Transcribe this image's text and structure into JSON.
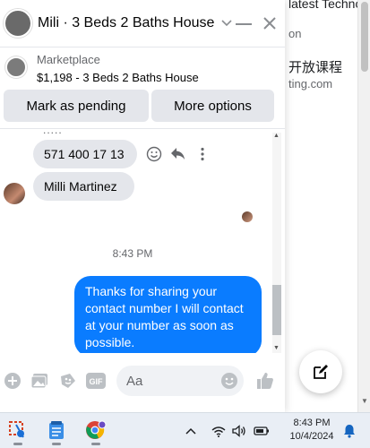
{
  "background_page": {
    "line1": "latest Technology",
    "line2": "on",
    "line3": "开放课程",
    "line4": "ting.com"
  },
  "chat": {
    "title": "Mili · 3 Beds 2 Baths House",
    "marketplace": {
      "label": "Marketplace",
      "listing": "$1,198 - 3 Beds 2 Baths House"
    },
    "actions": {
      "pending": "Mark as pending",
      "more": "More options"
    },
    "messages": {
      "dots": ".....",
      "phone": "571 400 17 13",
      "name": "Milli Martinez",
      "timestamp": "8:43 PM",
      "outgoing": "Thanks for sharing your contact number I will contact at your number as soon as possible."
    },
    "composer": {
      "placeholder": "Aa",
      "gif_label": "GIF"
    }
  },
  "taskbar": {
    "time": "8:43 PM",
    "date": "10/4/2024"
  },
  "colors": {
    "accent": "#0a7cff",
    "icon": "#8a8d91",
    "bubble_in": "#e4e6eb"
  }
}
